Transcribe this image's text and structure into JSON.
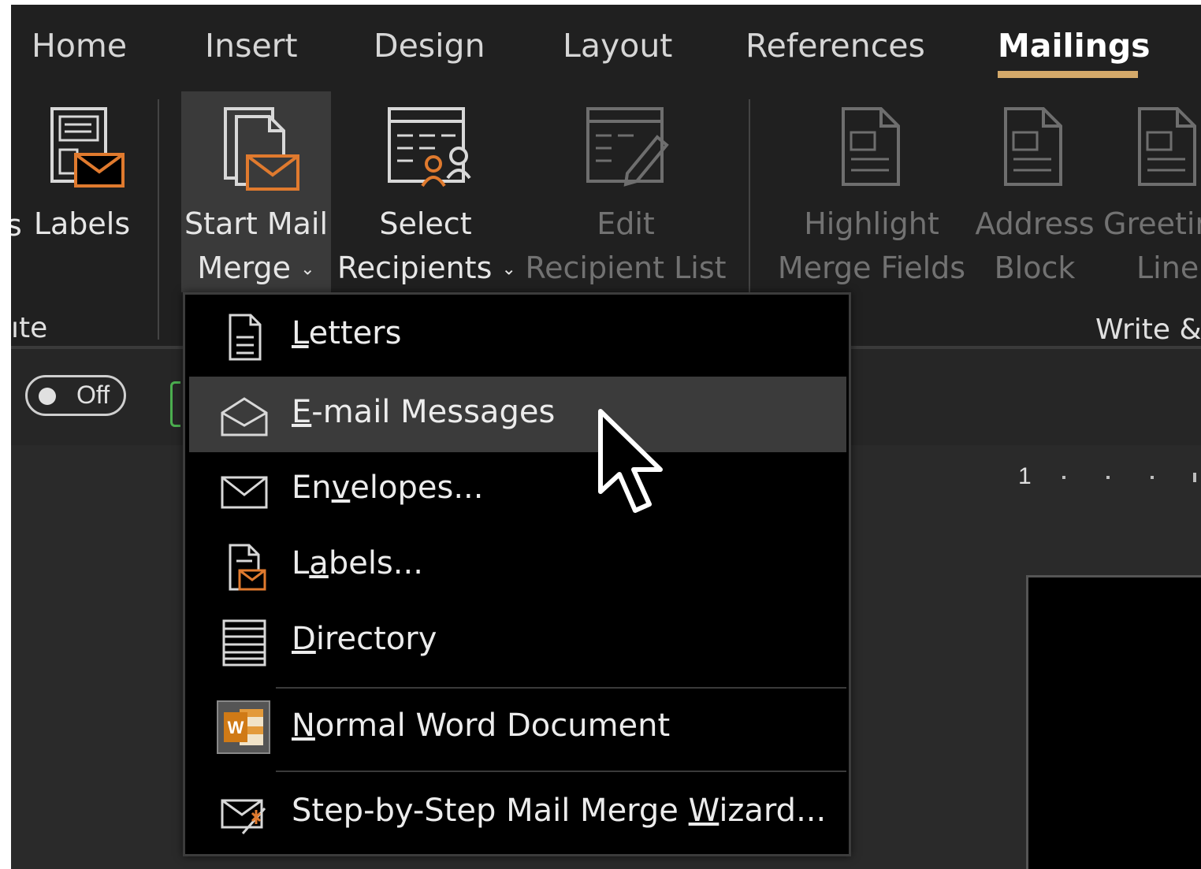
{
  "tabs": [
    {
      "label": "Home"
    },
    {
      "label": "Insert"
    },
    {
      "label": "Design"
    },
    {
      "label": "Layout"
    },
    {
      "label": "References"
    },
    {
      "label": "Mailings",
      "active": true
    }
  ],
  "ribbon": {
    "labels_button": {
      "label": "Labels",
      "partial_left": "s"
    },
    "start_mail_merge": {
      "line1": "Start Mail",
      "line2": "Merge",
      "chevron": "⌄"
    },
    "select_recipients": {
      "line1": "Select",
      "line2": "Recipients",
      "chevron": "⌄"
    },
    "edit_recipient_list": {
      "line1": "Edit",
      "line2": "Recipient List"
    },
    "highlight_merge_fields": {
      "line1": "Highlight",
      "line2": "Merge Fields"
    },
    "address_block": {
      "line1": "Address",
      "line2": "Block"
    },
    "greeting_line": {
      "line1": "Greetir",
      "line2": "Line"
    },
    "group_create_label": "ıte",
    "group_write_label": "Write &"
  },
  "toolbar_strip": {
    "toggle_label": "Off"
  },
  "ruler": {
    "number": "1"
  },
  "menu": {
    "items": [
      {
        "label": "Letters",
        "accel": "L",
        "icon": "document-icon"
      },
      {
        "label": "E-mail Messages",
        "accel": "E",
        "icon": "open-envelope-icon",
        "hovered": true
      },
      {
        "label": "Envelopes...",
        "accel": "v",
        "icon": "envelope-icon"
      },
      {
        "label": "Labels...",
        "accel": "a",
        "icon": "labels-icon"
      },
      {
        "label": "Directory",
        "accel": "D",
        "icon": "directory-icon"
      },
      {
        "label": "Normal Word Document",
        "accel": "N",
        "icon": "word-icon"
      },
      {
        "label": "Step-by-Step Mail Merge Wizard...",
        "accel": "W",
        "icon": "wizard-icon"
      }
    ]
  },
  "colors": {
    "accent_underline": "#d4a96a",
    "envelope_orange": "#e07a2e",
    "hover_bg": "#3b3b3b",
    "ribbon_bg": "#202020",
    "menu_bg": "#000000"
  }
}
